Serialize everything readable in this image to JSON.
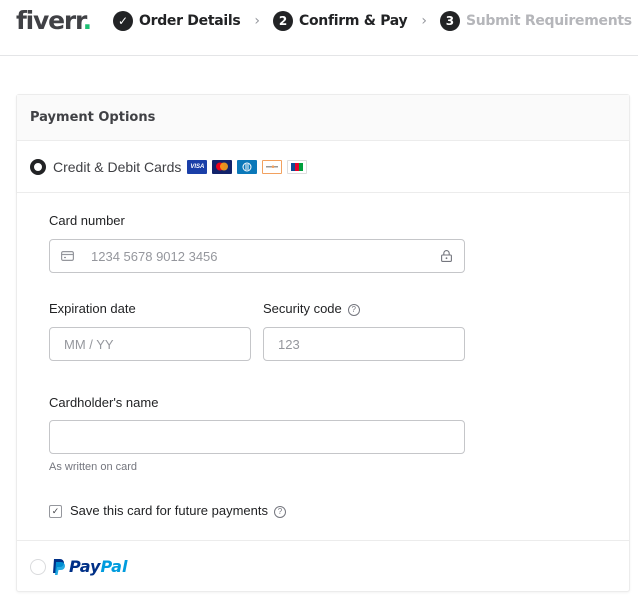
{
  "header": {
    "logo": "fiverr",
    "logo_dot": ".",
    "steps": [
      {
        "marker": "✓",
        "label": "Order Details",
        "state": "complete"
      },
      {
        "marker": "2",
        "label": "Confirm & Pay",
        "state": "active"
      },
      {
        "marker": "3",
        "label": "Submit Requirements",
        "state": "inactive"
      }
    ],
    "separator": "›"
  },
  "payment": {
    "title": "Payment Options",
    "options": [
      {
        "label": "Credit & Debit Cards",
        "selected": true,
        "card_brands": [
          "VISA",
          "Mastercard",
          "Diners",
          "Discover",
          "JCB"
        ]
      },
      {
        "label": "PayPal",
        "selected": false,
        "brand_pay": "Pay",
        "brand_pal": "Pal"
      }
    ],
    "form": {
      "card_number": {
        "label": "Card number",
        "placeholder": "1234 5678 9012 3456",
        "value": ""
      },
      "expiration": {
        "label": "Expiration date",
        "placeholder": "MM / YY",
        "value": ""
      },
      "security_code": {
        "label": "Security code",
        "placeholder": "123",
        "value": ""
      },
      "cardholder": {
        "label": "Cardholder's name",
        "value": "",
        "hint": "As written on card"
      },
      "save_card": {
        "label": "Save this card for future payments",
        "checked": true
      }
    }
  },
  "colors": {
    "brand_green": "#1dbf73",
    "text_dark": "#222325",
    "text_muted": "#b5b6ba",
    "paypal_dark": "#003087",
    "paypal_light": "#009cde"
  }
}
